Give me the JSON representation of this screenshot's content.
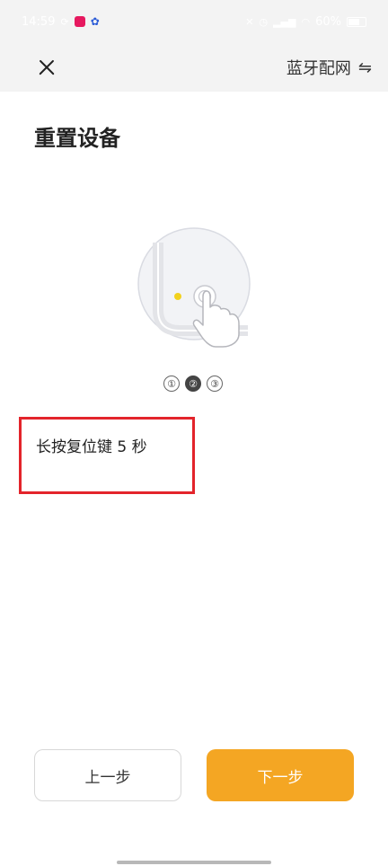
{
  "status_bar": {
    "time": "14:59",
    "battery": "60%"
  },
  "header": {
    "mode_label": "蓝牙配网",
    "swap_icon": "⇋"
  },
  "page": {
    "title": "重置设备"
  },
  "steps": [
    "①",
    "②",
    "③"
  ],
  "instruction": "长按复位键 5 秒",
  "buttons": {
    "prev": "上一步",
    "next": "下一步"
  },
  "colors": {
    "accent": "#f4a623",
    "highlight_box": "#e3242b"
  }
}
